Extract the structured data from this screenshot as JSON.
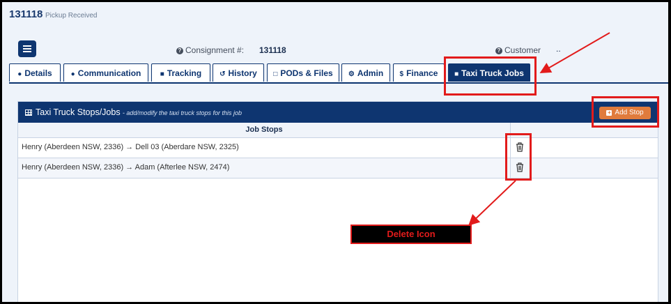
{
  "header": {
    "job_number": "131118",
    "status": "Pickup Received",
    "consignment_label": "Consignment #:",
    "consignment_value": "131118",
    "customer_label": "Customer",
    "customer_value": ".."
  },
  "tabs": [
    {
      "label": "Details",
      "icon": "user-icon"
    },
    {
      "label": "Communication",
      "icon": "comment-icon"
    },
    {
      "label": "Tracking",
      "icon": "truck-icon"
    },
    {
      "label": "History",
      "icon": "history-icon"
    },
    {
      "label": "PODs & Files",
      "icon": "file-icon"
    },
    {
      "label": "Admin",
      "icon": "gear-icon"
    },
    {
      "label": "Finance",
      "icon": "dollar-icon"
    },
    {
      "label": "Taxi Truck Jobs",
      "icon": "truck-icon",
      "active": true
    }
  ],
  "panel": {
    "title": "Taxi Truck Stops/Jobs",
    "subtitle": "- add/modify the taxi truck stops for this job",
    "add_button": "Add Stop",
    "column_header": "Job Stops",
    "rows": [
      {
        "stops": "Henry (Aberdeen NSW, 2336) → Dell 03 (Aberdare NSW, 2325)"
      },
      {
        "stops": "Henry (Aberdeen NSW, 2336) → Adam (Afterlee NSW, 2474)"
      }
    ]
  },
  "annotation": {
    "delete_label": "Delete Icon"
  },
  "colors": {
    "primary": "#0e3570",
    "accent": "#e07b3c",
    "annotation": "#e21b1b"
  }
}
